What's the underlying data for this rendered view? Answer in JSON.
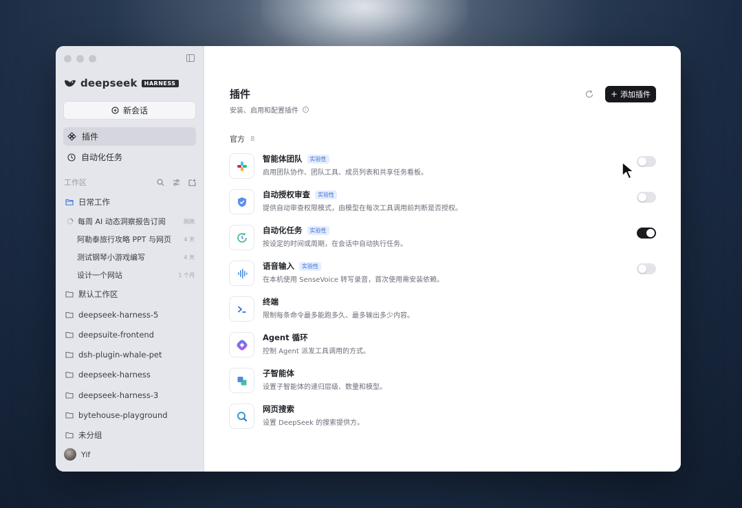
{
  "brand": {
    "name": "deepseek",
    "tag": "HARNESS"
  },
  "sidebar": {
    "new_chat_label": "新会话",
    "nav": [
      {
        "label": "插件",
        "icon": "plugin-icon",
        "active": true
      },
      {
        "label": "自动化任务",
        "icon": "clock-icon",
        "active": false
      }
    ],
    "workspace_header": "工作区",
    "workspace_folder": "日常工作",
    "chats": [
      {
        "title": "每周 AI 动态洞察报告订阅",
        "time": "刚刚"
      },
      {
        "title": "阿勒泰旅行攻略 PPT 与网页",
        "time": "4 天"
      },
      {
        "title": "测试钢琴小游戏编写",
        "time": "4 天"
      },
      {
        "title": "设计一个网站",
        "time": "1 个月"
      }
    ],
    "folders": [
      "默认工作区",
      "deepseek-harness-5",
      "deepsuite-frontend",
      "dsh-plugin-whale-pet",
      "deepseek-harness",
      "deepseek-harness-3",
      "bytehouse-playground",
      "未分组"
    ],
    "user_name": "Yif"
  },
  "main": {
    "title": "插件",
    "subtitle": "安装、启用和配置插件",
    "add_button_label": "添加插件",
    "section_label": "官方",
    "section_count": "8",
    "plugins": [
      {
        "name": "智能体团队",
        "badge": "实验性",
        "desc": "启用团队协作、团队工具、成员列表和共享任务看板。",
        "toggle": "off",
        "icon": "team-icon"
      },
      {
        "name": "自动授权审查",
        "badge": "实验性",
        "desc": "提供自动审查权限模式，由模型在每次工具调用前判断是否授权。",
        "toggle": "off",
        "icon": "shield-icon"
      },
      {
        "name": "自动化任务",
        "badge": "实验性",
        "desc": "按设定的时间或周期，在会话中自动执行任务。",
        "toggle": "on",
        "icon": "clock-icon"
      },
      {
        "name": "语音输入",
        "badge": "实验性",
        "desc": "在本机使用 SenseVoice 转写录音，首次使用需安装依赖。",
        "toggle": "off",
        "icon": "waveform-icon"
      },
      {
        "name": "终端",
        "badge": "",
        "desc": "限制每条命令最多能跑多久、最多输出多少内容。",
        "toggle": "",
        "icon": "terminal-icon"
      },
      {
        "name": "Agent 循环",
        "badge": "",
        "desc": "控制 Agent 派发工具调用的方式。",
        "toggle": "",
        "icon": "loop-icon"
      },
      {
        "name": "子智能体",
        "badge": "",
        "desc": "设置子智能体的递归层级、数量和模型。",
        "toggle": "",
        "icon": "subagent-icon"
      },
      {
        "name": "网页搜索",
        "badge": "",
        "desc": "设置 DeepSeek 的搜索提供方。",
        "toggle": "",
        "icon": "search-icon"
      }
    ]
  }
}
